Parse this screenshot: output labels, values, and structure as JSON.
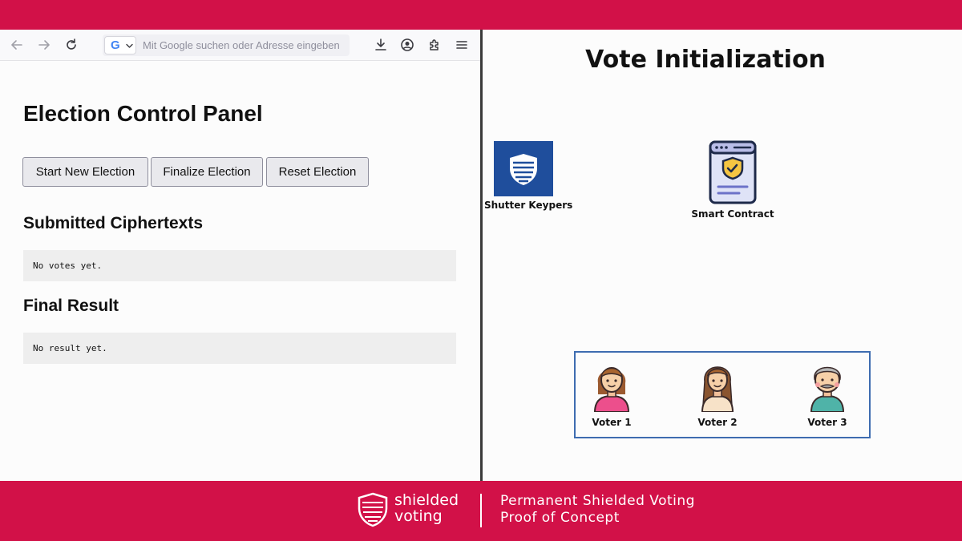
{
  "browser": {
    "url_placeholder": "Mit Google suchen oder Adresse eingeben",
    "search_engine_letter": "G",
    "icons": [
      "back-arrow-icon",
      "forward-arrow-icon",
      "reload-icon",
      "download-icon",
      "account-icon",
      "extensions-icon",
      "menu-icon"
    ]
  },
  "panel": {
    "title": "Election Control Panel",
    "buttons": {
      "start": "Start New Election",
      "finalize": "Finalize Election",
      "reset": "Reset Election"
    },
    "ciphertexts": {
      "heading": "Submitted Ciphertexts",
      "content": "No votes yet."
    },
    "result": {
      "heading": "Final Result",
      "content": "No result yet."
    }
  },
  "slide": {
    "title": "Vote Initialization",
    "keypers_label": "Shutter Keypers",
    "contract_label": "Smart Contract",
    "voters": [
      "Voter 1",
      "Voter 2",
      "Voter 3"
    ]
  },
  "footer": {
    "brand_line1": "shielded",
    "brand_line2": "voting",
    "tagline_line1": "Permanent Shielded Voting",
    "tagline_line2": "Proof of Concept"
  },
  "colors": {
    "brand_red": "#d21148",
    "keyper_blue": "#1f4e9c",
    "voters_border": "#3e6cb0"
  }
}
